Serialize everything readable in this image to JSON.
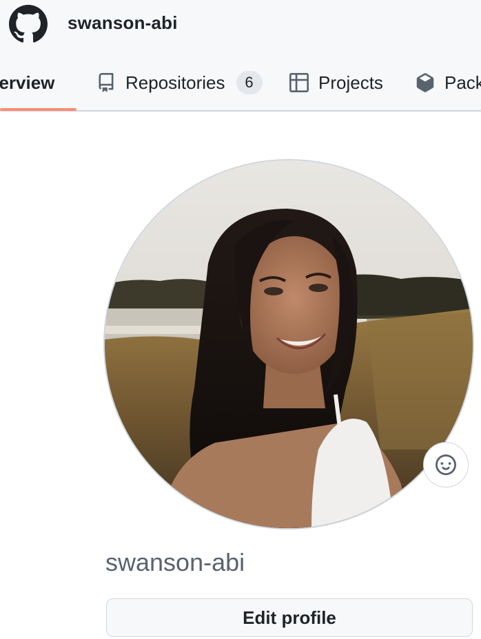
{
  "header": {
    "logo_icon": "github-mark-icon",
    "username": "swanson-abi"
  },
  "tabs": [
    {
      "label": "Overview",
      "visible_text": "verview",
      "icon": "book-open-icon",
      "selected": true
    },
    {
      "label": "Repositories",
      "icon": "repo-icon",
      "count": "6",
      "selected": false
    },
    {
      "label": "Projects",
      "icon": "table-icon",
      "selected": false
    },
    {
      "label": "Packages",
      "visible_text": "Pack",
      "icon": "package-icon",
      "selected": false
    }
  ],
  "profile": {
    "avatar_description_icon": "avatar",
    "status_icon": "smiley-icon",
    "login": "swanson-abi",
    "edit_button_label": "Edit profile"
  },
  "colors": {
    "header_bg": "#f6f8fa",
    "selected_tab_underline": "#fd8c73",
    "counter_bg": "#e4e8ec",
    "border": "#d0d7de",
    "muted_text": "#59636e"
  }
}
